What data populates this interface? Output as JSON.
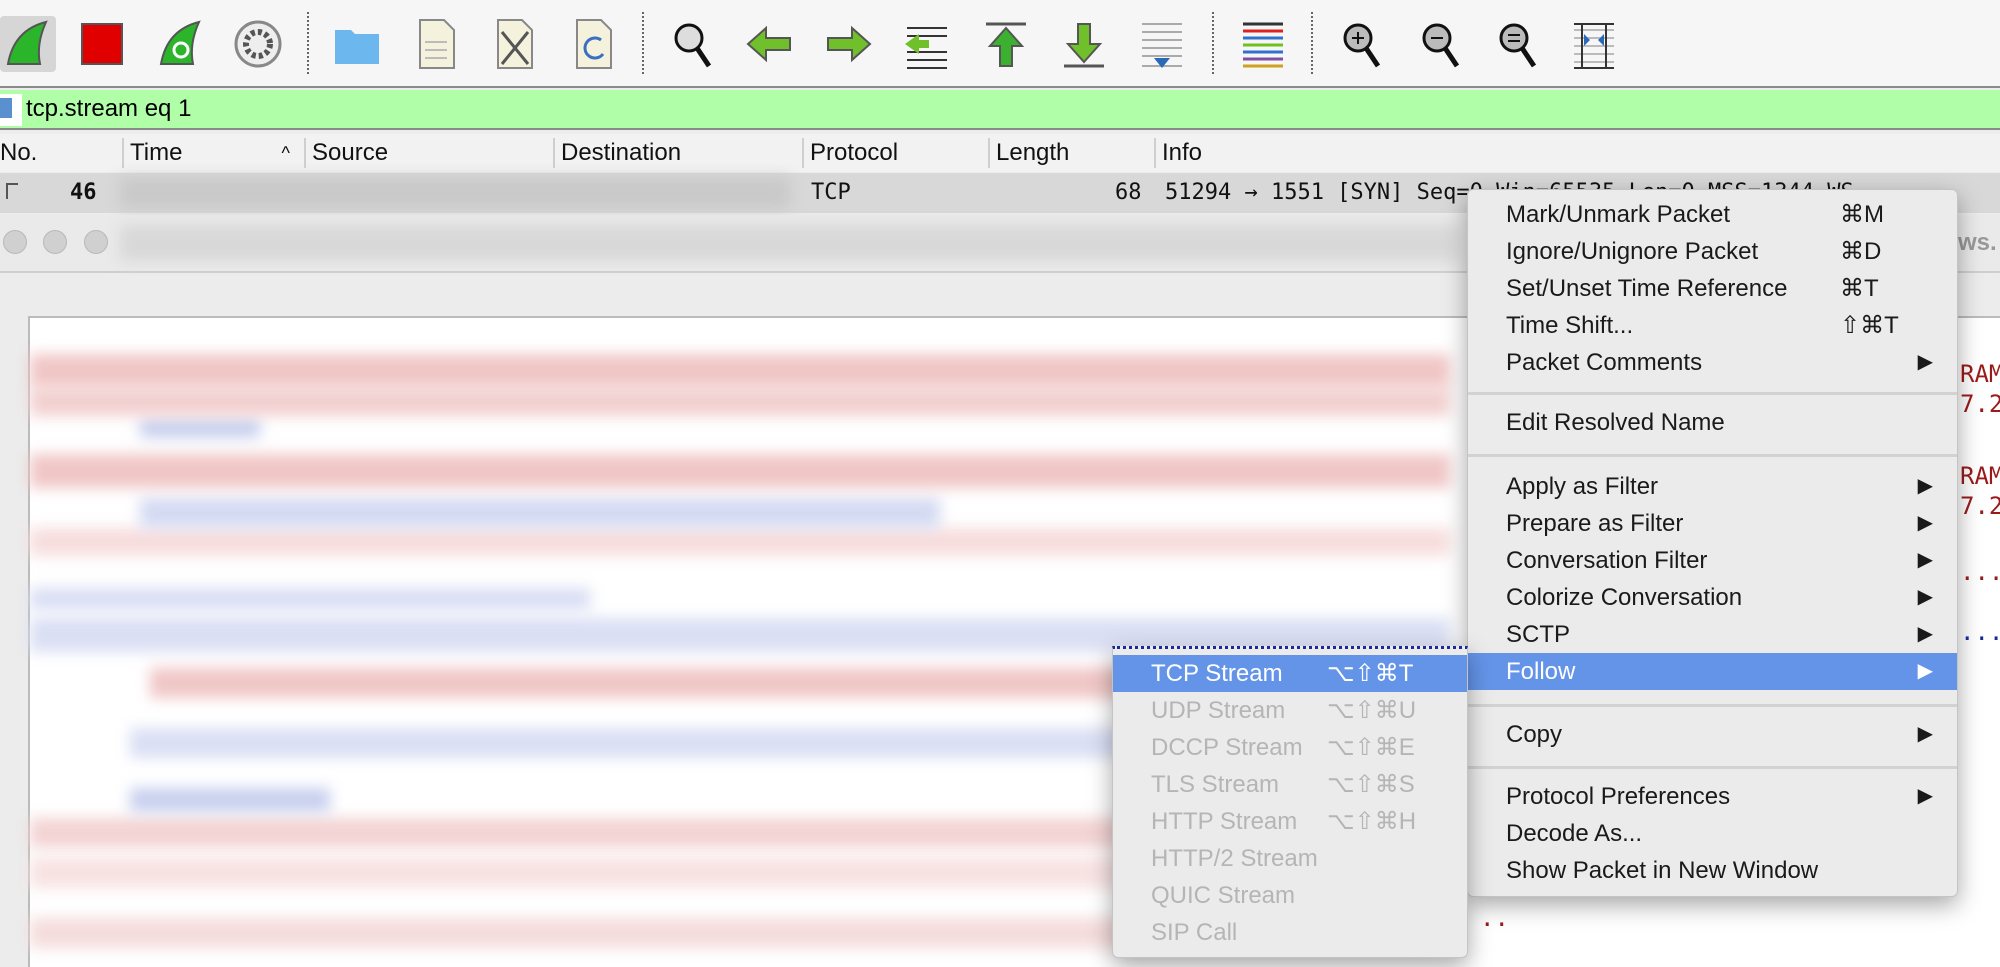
{
  "toolbar": {
    "icons": [
      "start-capture-icon",
      "stop-capture-icon",
      "restart-capture-icon",
      "capture-options-icon",
      "open-file-icon",
      "save-file-icon",
      "close-file-icon",
      "reload-file-icon",
      "find-packet-icon",
      "go-back-icon",
      "go-forward-icon",
      "go-to-packet-icon",
      "first-packet-icon",
      "last-packet-icon",
      "auto-scroll-icon",
      "colorize-icon",
      "zoom-in-icon",
      "zoom-out-icon",
      "normal-size-icon",
      "resize-columns-icon"
    ]
  },
  "filter": {
    "value": "tcp.stream eq 1",
    "color": "#b0ffa8"
  },
  "columns": [
    "No.",
    "Time",
    "Source",
    "Destination",
    "Protocol",
    "Length",
    "Info"
  ],
  "sort_indicator": "^",
  "packet": {
    "no": "46",
    "protocol": "TCP",
    "length": "68",
    "info": "51294 → 1551 [SYN] Seq=0 Win=65535 Len=0 MSS=1344 WS"
  },
  "fragments": [
    "ws.",
    "RAM",
    "7.2",
    "RAM",
    "7.2",
    "...",
    "..",
    "..."
  ],
  "context_menu": {
    "items": [
      {
        "label": "Mark/Unmark Packet",
        "shortcut": "⌘M"
      },
      {
        "label": "Ignore/Unignore Packet",
        "shortcut": "⌘D"
      },
      {
        "label": "Set/Unset Time Reference",
        "shortcut": "⌘T"
      },
      {
        "label": "Time Shift...",
        "shortcut": "⇧⌘T"
      },
      {
        "label": "Packet Comments",
        "submenu": true
      },
      {
        "label": "Edit Resolved Name"
      },
      {
        "label": "Apply as Filter",
        "submenu": true
      },
      {
        "label": "Prepare as Filter",
        "submenu": true
      },
      {
        "label": "Conversation Filter",
        "submenu": true
      },
      {
        "label": "Colorize Conversation",
        "submenu": true
      },
      {
        "label": "SCTP",
        "submenu": true
      },
      {
        "label": "Follow",
        "submenu": true,
        "highlighted": true
      },
      {
        "label": "Copy",
        "submenu": true
      },
      {
        "label": "Protocol Preferences",
        "submenu": true
      },
      {
        "label": "Decode As..."
      },
      {
        "label": "Show Packet in New Window"
      }
    ]
  },
  "follow_submenu": {
    "items": [
      {
        "label": "TCP Stream",
        "shortcut": "⌥⇧⌘T",
        "highlighted": true
      },
      {
        "label": "UDP Stream",
        "shortcut": "⌥⇧⌘U",
        "disabled": true
      },
      {
        "label": "DCCP Stream",
        "shortcut": "⌥⇧⌘E",
        "disabled": true
      },
      {
        "label": "TLS Stream",
        "shortcut": "⌥⇧⌘S",
        "disabled": true
      },
      {
        "label": "HTTP Stream",
        "shortcut": "⌥⇧⌘H",
        "disabled": true
      },
      {
        "label": "HTTP/2 Stream",
        "disabled": true
      },
      {
        "label": "QUIC Stream",
        "disabled": true
      },
      {
        "label": "SIP Call",
        "disabled": true
      }
    ]
  },
  "arrow": "▶",
  "highlight_color": "#6494e8"
}
